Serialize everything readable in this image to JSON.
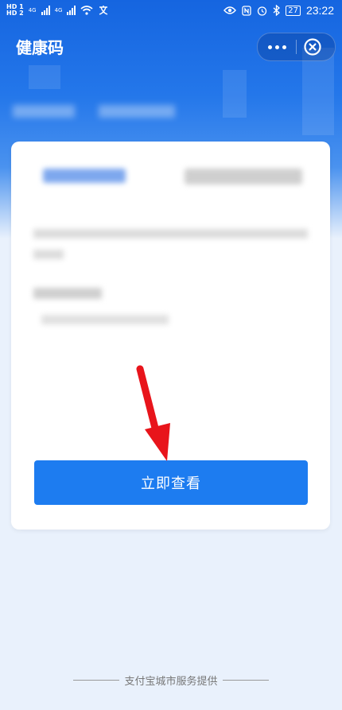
{
  "status_bar": {
    "left_badges": [
      "HD 1",
      "HD 2"
    ],
    "network_1": "4G",
    "network_2": "4G",
    "battery": "27",
    "time": "23:22"
  },
  "nav": {
    "title": "健康码",
    "more_icon": "more-dots-icon",
    "close_icon": "close-circle-icon"
  },
  "header_tabs_blurred": [
    "",
    ""
  ],
  "card": {
    "logo_text": "",
    "title_blurred": "",
    "description_blurred": "",
    "sub_title_blurred": "",
    "sub_line_blurred": "",
    "primary_button": "立即查看"
  },
  "annotation": {
    "arrow_color": "#e8141b"
  },
  "footer": {
    "provider_text": "支付宝城市服务提供"
  },
  "colors": {
    "brand_blue": "#1d7cf0",
    "header_blue": "#1565e0",
    "page_bg": "#e9f1fc"
  }
}
